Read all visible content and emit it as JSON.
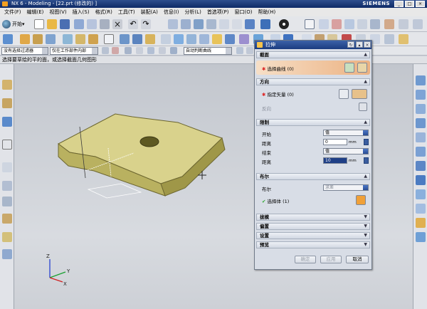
{
  "window": {
    "title": "NX 6 - Modeling - [22.prt (修改的) ]",
    "brand": "SIEMENS",
    "controls": [
      "_",
      "□",
      "×"
    ]
  },
  "menu": [
    "文件(F)",
    "编辑(E)",
    "视图(V)",
    "插入(S)",
    "格式(R)",
    "工具(T)",
    "装配(A)",
    "信息(I)",
    "分析(L)",
    "首选项(P)",
    "窗口(O)",
    "帮助(H)"
  ],
  "toolbar": {
    "start_label": "开始▾"
  },
  "selbar": {
    "filter": "没有选择过滤器",
    "scope": "仅在工作部件内部",
    "curve_rule": "自动判断曲线"
  },
  "prompt": "选择要草绘的平的面，或选择截面几何图形",
  "triad": {
    "x": "X",
    "y": "Y",
    "z": "Z"
  },
  "dialog": {
    "title": "拉伸",
    "section": {
      "header": "截面",
      "select_curve": "选择曲线 (0)"
    },
    "direction": {
      "header": "方向",
      "specify_vector": "指定矢量 (0)",
      "reverse": "反向"
    },
    "limits": {
      "header": "限制",
      "start_label": "开始",
      "start_value": "值",
      "dist1_label": "距离",
      "dist1_value": "0",
      "dist1_unit": "mm",
      "end_label": "结束",
      "end_value": "值",
      "dist2_label": "距离",
      "dist2_value": "10",
      "dist2_unit": "mm"
    },
    "boolean": {
      "header": "布尔",
      "label": "布尔",
      "value": "求差",
      "select_body": "选择体 (1)"
    },
    "collapsed": [
      "拔模",
      "偏置",
      "设置",
      "预览"
    ],
    "buttons": {
      "ok": "确定",
      "apply": "应用",
      "cancel": "取消"
    }
  },
  "colors": {
    "accent": "#1b3c80",
    "highlight": "#ecb282",
    "model": "#c9c27a"
  }
}
